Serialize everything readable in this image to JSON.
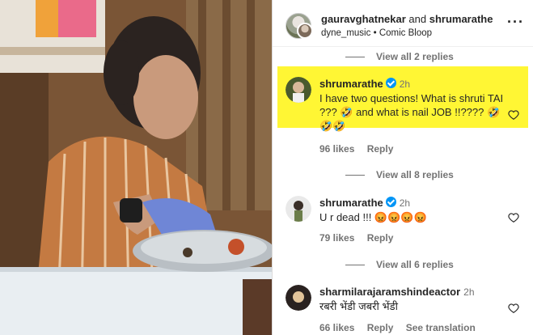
{
  "post": {
    "authors_primary": "gauravghatnekar",
    "authors_and": "and",
    "authors_secondary": "shrumarathe",
    "audio_artist": "dyne_music",
    "audio_sep": "•",
    "audio_title": "Comic Bloop",
    "more_icon": "more-options-icon"
  },
  "comments_top_viewall": "View all 2 replies",
  "comments": [
    {
      "username": "shrumarathe",
      "verified": true,
      "time": "2h",
      "text": "I have two questions! What is shruti TAI ??? 🤣 and what is nail JOB !!???? 🤣🤣🤣",
      "likes": "96 likes",
      "reply": "Reply",
      "highlighted": true,
      "highlight_color": "#fff634"
    },
    {
      "username": "shrumarathe",
      "verified": true,
      "time": "2h",
      "text": "U r dead !!! 😡😡😡😡",
      "likes": "79 likes",
      "reply": "Reply"
    },
    {
      "username": "sharmilarajaramshindeactor",
      "verified": false,
      "time": "2h",
      "text": "रबरी भेंडी जबरी भेंडी",
      "likes": "66 likes",
      "reply": "Reply",
      "translation": "See translation"
    }
  ],
  "replies_1": "View all 8 replies",
  "replies_2": "View all 6 replies",
  "colors": {
    "accent_verified": "#0095f6",
    "muted": "#737373"
  }
}
